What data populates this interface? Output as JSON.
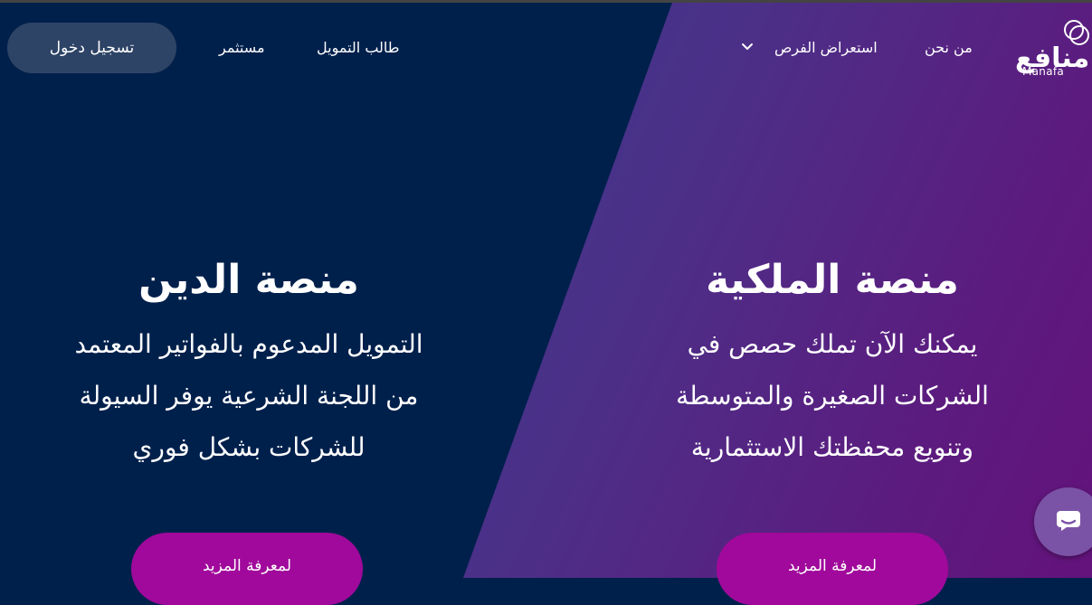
{
  "header": {
    "logo": {
      "arabic": "منافع",
      "latin": "Manafa"
    },
    "nav": {
      "about": "من نحن",
      "browse_opportunities": "استعراض الفرص",
      "funding_seeker": "طالب التمويل",
      "investor": "مستثمر"
    },
    "login_label": "تسجيل دخول"
  },
  "hero": {
    "ownership": {
      "title": "منصة الملكية",
      "lines": [
        "يمكنك الآن تملك حصص في",
        "الشركات الصغيرة والمتوسطة",
        "وتنويع محفظتك الاستثمارية"
      ],
      "button": "لمعرفة المزيد"
    },
    "debt": {
      "title": "منصة الدين",
      "lines": [
        "التمويل المدعوم بالفواتير المعتمد",
        "من اللجنة الشرعية يوفر السيولة",
        "للشركات بشكل فوري"
      ],
      "button": "لمعرفة المزيد"
    }
  },
  "icons": {
    "nav_dropdown": "chevron-down-icon",
    "chat": "chat-icon",
    "logo": "logo-circles-icon"
  },
  "colors": {
    "navy_background": "#00204c",
    "gradient_start": "#2a4893",
    "gradient_end": "#63137b",
    "login_button": "#2e4466",
    "cta_button": "#a0099b",
    "chat_button": "#7b53a6"
  }
}
